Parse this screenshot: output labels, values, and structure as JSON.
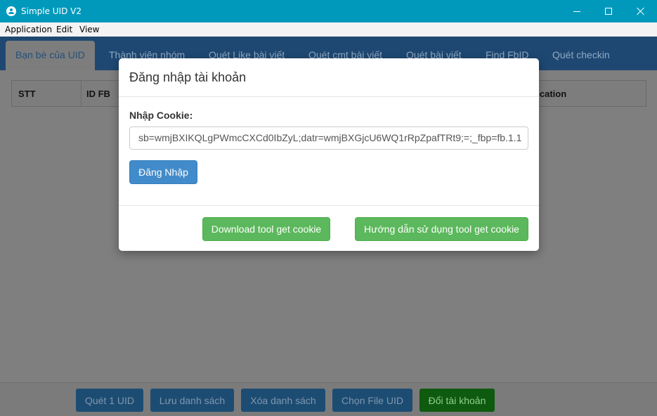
{
  "window": {
    "title": "Simple UID V2"
  },
  "menu": [
    "Application",
    "Edit",
    "View"
  ],
  "tabs": [
    "Bạn bè của UID",
    "Thành viên nhóm",
    "Quét Like bài viết",
    "Quét cmt bài viết",
    "Quét bài viết",
    "Find FbID",
    "Quét checkin"
  ],
  "grid": {
    "columns": [
      "STT",
      "ID FB",
      "Location"
    ]
  },
  "bottom_buttons": [
    "Quét 1 UID",
    "Lưu danh sách",
    "Xóa danh sách",
    "Chọn File UID",
    "Đổi tài khoản"
  ],
  "dialog": {
    "title": "Đăng nhập tài khoản",
    "cookie_label": "Nhập Cookie:",
    "cookie_value": "sb=wmjBXIKQLgPWmcCXCd0IbZyL;datr=wmjBXGjcU6WQ1rRpZpafTRt9;=;_fbp=fb.1.1",
    "login_button": "Đăng Nhập",
    "download_button": "Download tool get cookie",
    "guide_button": "Hướng dẫn sử dụng tool get cookie"
  }
}
